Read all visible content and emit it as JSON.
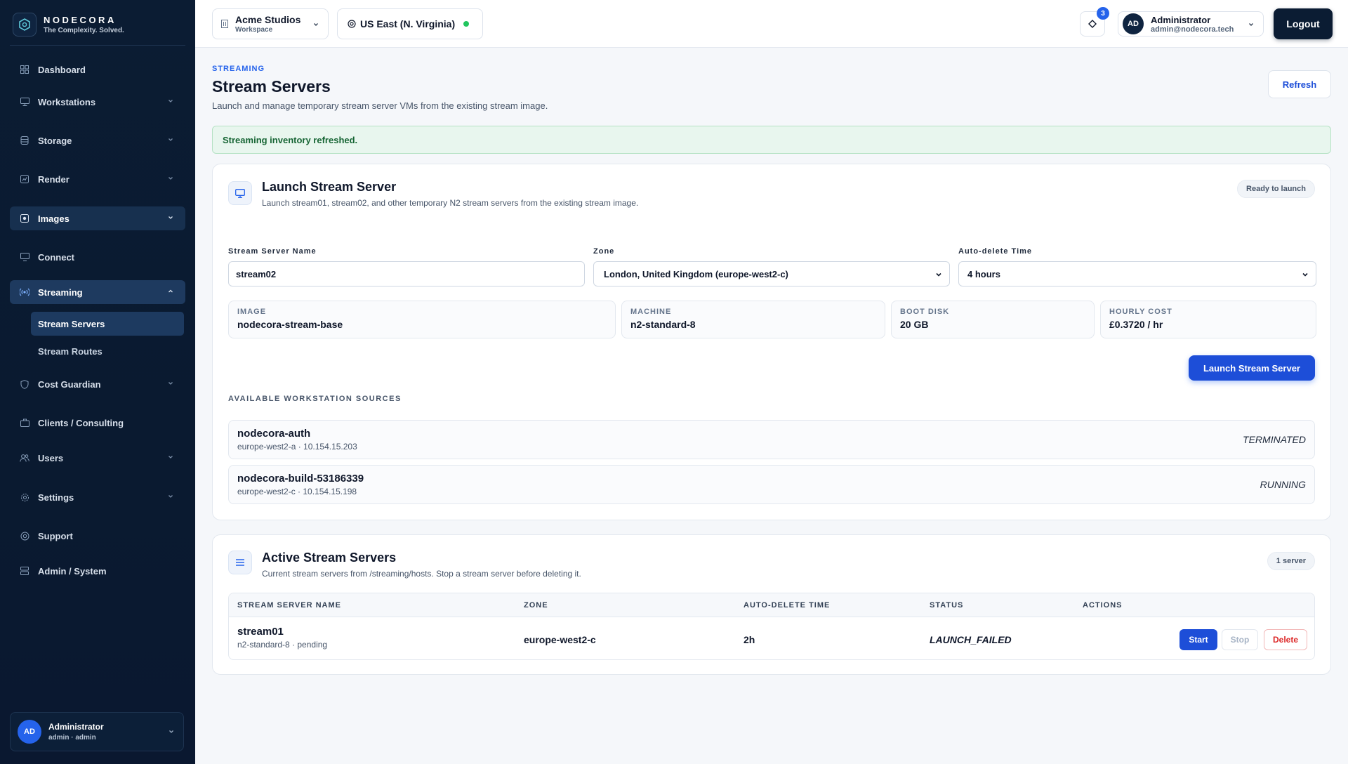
{
  "brand": {
    "name": "NODECORA",
    "tagline": "The Complexity. Solved."
  },
  "sidebar": {
    "items": [
      {
        "label": "Dashboard",
        "icon": "dashboard-icon",
        "chevron": false
      },
      {
        "label": "Workstations",
        "icon": "monitor-icon",
        "chevron": true
      },
      {
        "label": "Storage",
        "icon": "database-icon",
        "chevron": true
      },
      {
        "label": "Render",
        "icon": "render-icon",
        "chevron": true
      },
      {
        "label": "Images",
        "icon": "image-icon",
        "chevron": true
      },
      {
        "label": "Connect",
        "icon": "connect-icon",
        "chevron": false
      },
      {
        "label": "Streaming",
        "icon": "broadcast-icon",
        "chevron": true
      },
      {
        "label": "Cost Guardian",
        "icon": "shield-icon",
        "chevron": true
      },
      {
        "label": "Clients / Consulting",
        "icon": "briefcase-icon",
        "chevron": false
      },
      {
        "label": "Users",
        "icon": "users-icon",
        "chevron": true
      },
      {
        "label": "Settings",
        "icon": "gear-icon",
        "chevron": true
      },
      {
        "label": "Support",
        "icon": "lifebuoy-icon",
        "chevron": false
      },
      {
        "label": "Admin / System",
        "icon": "server-icon",
        "chevron": false
      }
    ],
    "streaming_sub": [
      "Stream Servers",
      "Stream Routes"
    ],
    "user": {
      "initials": "AD",
      "name": "Administrator",
      "sub": "admin · admin"
    }
  },
  "topbar": {
    "workspace": {
      "name": "Acme Studios",
      "label": "Workspace"
    },
    "region": "US East (N. Virginia)",
    "notifications": "3",
    "account": {
      "initials": "AD",
      "name": "Administrator",
      "email": "admin@nodecora.tech"
    },
    "logout": "Logout"
  },
  "page": {
    "eyebrow": "STREAMING",
    "title": "Stream Servers",
    "subtitle": "Launch and manage temporary stream server VMs from the existing stream image.",
    "refresh": "Refresh",
    "alert": "Streaming inventory refreshed."
  },
  "launch": {
    "title": "Launch Stream Server",
    "subtitle": "Launch stream01, stream02, and other temporary N2 stream servers from the existing stream image.",
    "status": "Ready to launch",
    "name_label": "Stream Server Name",
    "name_value": "stream02",
    "zone_label": "Zone",
    "zone_value": "London, United Kingdom (europe-west2-c)",
    "auto_label": "Auto-delete Time",
    "auto_value": "4 hours",
    "stats": [
      {
        "key": "IMAGE",
        "value": "nodecora-stream-base"
      },
      {
        "key": "MACHINE",
        "value": "n2-standard-8"
      },
      {
        "key": "BOOT DISK",
        "value": "20 GB"
      },
      {
        "key": "HOURLY COST",
        "value": "£0.3720 / hr"
      }
    ],
    "button": "Launch Stream Server",
    "sources_label": "AVAILABLE WORKSTATION SOURCES",
    "sources": [
      {
        "name": "nodecora-auth",
        "meta": "europe-west2-a · 10.154.15.203",
        "status": "TERMINATED"
      },
      {
        "name": "nodecora-build-53186339",
        "meta": "europe-west2-c · 10.154.15.198",
        "status": "RUNNING"
      }
    ]
  },
  "active": {
    "title": "Active Stream Servers",
    "subtitle": "Current stream servers from /streaming/hosts. Stop a stream server before deleting it.",
    "count": "1 server",
    "columns": [
      "STREAM SERVER NAME",
      "ZONE",
      "AUTO-DELETE TIME",
      "STATUS",
      "ACTIONS"
    ],
    "rows": [
      {
        "name": "stream01",
        "meta": "n2-standard-8 · pending",
        "zone": "europe-west2-c",
        "auto": "2h",
        "status": "LAUNCH_FAILED"
      }
    ],
    "actions": {
      "start": "Start",
      "stop": "Stop",
      "delete": "Delete"
    }
  }
}
